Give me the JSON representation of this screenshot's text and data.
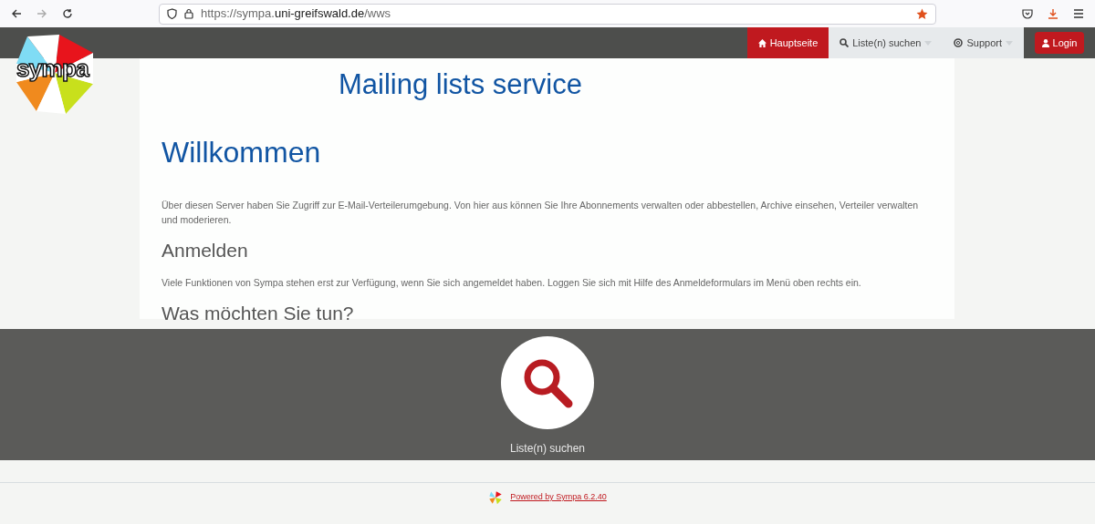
{
  "browser": {
    "url": "https://sympa.**uni-greifswald.de**/wws",
    "bookmarked": true
  },
  "logo": {
    "text": "sympa"
  },
  "nav": {
    "items": [
      {
        "label": "Hauptseite",
        "kind": "home",
        "selected": true,
        "dropdown": false
      },
      {
        "label": "Liste(n) suchen",
        "kind": "search",
        "selected": false,
        "dropdown": true
      },
      {
        "label": "Support",
        "kind": "lifebuoy",
        "selected": false,
        "dropdown": true
      }
    ],
    "login": "Login"
  },
  "title": "Mailing lists service",
  "content": [
    {
      "kind": "h1",
      "text": "Willkommen"
    },
    {
      "kind": "p",
      "text": "Über diesen Server haben Sie Zugriff zur E-Mail-Verteilerumgebung. Von hier aus können Sie Ihre Abonnements verwalten oder abbestellen, Archive einsehen, Verteiler verwalten und moderieren."
    },
    {
      "kind": "h2",
      "text": "Anmelden"
    },
    {
      "kind": "p",
      "text": "Viele Funktionen von Sympa stehen erst zur Verfügung, wenn Sie sich angemeldet haben. Loggen Sie sich mit Hilfe des Anmeldeformulars im Menü oben rechts ein."
    },
    {
      "kind": "h2",
      "text": "Was möchten Sie tun?"
    }
  ],
  "actions": [
    {
      "label": "Liste(n) suchen"
    }
  ],
  "footer": {
    "link": "Powered by Sympa 6.2.40"
  }
}
